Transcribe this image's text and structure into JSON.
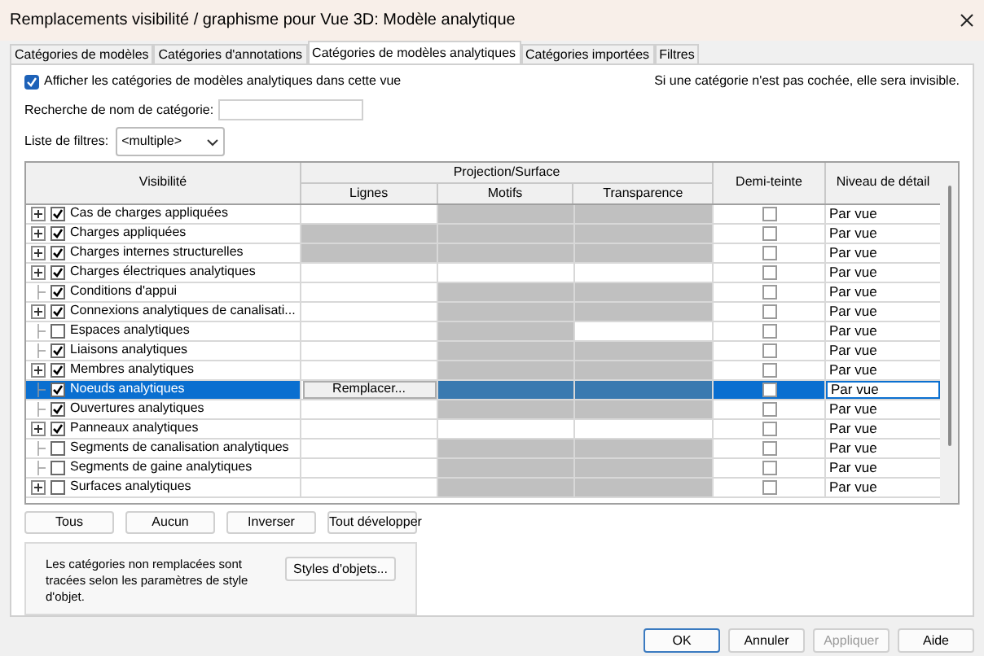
{
  "window": {
    "title": "Remplacements visibilité / graphisme pour Vue 3D: Modèle analytique"
  },
  "tabs": [
    {
      "label": "Catégories de modèles",
      "selected": false
    },
    {
      "label": "Catégories d'annotations",
      "selected": false
    },
    {
      "label": "Catégories de modèles analytiques",
      "selected": true
    },
    {
      "label": "Catégories importées",
      "selected": false
    },
    {
      "label": "Filtres",
      "selected": false
    }
  ],
  "show_categories": {
    "label": "Afficher les catégories de modèles analytiques dans cette vue",
    "checked": true
  },
  "hint": "Si une catégorie n'est pas cochée, elle sera invisible.",
  "search": {
    "label": "Recherche de nom de catégorie:"
  },
  "filter_list": {
    "label": "Liste de filtres:",
    "value": "<multiple>"
  },
  "table": {
    "columns": {
      "visibility": "Visibilité",
      "group": "Projection/Surface",
      "lines": "Lignes",
      "patterns": "Motifs",
      "transparency": "Transparence",
      "halftone": "Demi-teinte",
      "detail": "Niveau de détail"
    },
    "rows": [
      {
        "name": "Cas de charges appliquées",
        "expandable": true,
        "checked": true,
        "selected": false,
        "lines": {
          "shaded": false
        },
        "patterns": {
          "shaded": true
        },
        "transparency": {
          "shaded": true
        },
        "halftone": false,
        "detail": "Par vue"
      },
      {
        "name": "Charges appliquées",
        "expandable": true,
        "checked": true,
        "selected": false,
        "lines": {
          "shaded": true
        },
        "patterns": {
          "shaded": true
        },
        "transparency": {
          "shaded": true
        },
        "halftone": false,
        "detail": "Par vue"
      },
      {
        "name": "Charges internes structurelles",
        "expandable": true,
        "checked": true,
        "selected": false,
        "lines": {
          "shaded": true
        },
        "patterns": {
          "shaded": true
        },
        "transparency": {
          "shaded": true
        },
        "halftone": false,
        "detail": "Par vue"
      },
      {
        "name": "Charges électriques analytiques",
        "expandable": true,
        "checked": true,
        "selected": false,
        "lines": {
          "shaded": false
        },
        "patterns": {
          "shaded": false
        },
        "transparency": {
          "shaded": false
        },
        "halftone": false,
        "detail": "Par vue"
      },
      {
        "name": "Conditions d'appui",
        "expandable": false,
        "checked": true,
        "selected": false,
        "lines": {
          "shaded": false
        },
        "patterns": {
          "shaded": true
        },
        "transparency": {
          "shaded": true
        },
        "halftone": false,
        "detail": "Par vue"
      },
      {
        "name": "Connexions analytiques de canalisati...",
        "expandable": true,
        "checked": true,
        "selected": false,
        "lines": {
          "shaded": false
        },
        "patterns": {
          "shaded": true
        },
        "transparency": {
          "shaded": true
        },
        "halftone": false,
        "detail": "Par vue"
      },
      {
        "name": "Espaces analytiques",
        "expandable": false,
        "checked": false,
        "selected": false,
        "lines": {
          "shaded": false
        },
        "patterns": {
          "shaded": true
        },
        "transparency": {
          "shaded": false
        },
        "halftone": false,
        "detail": "Par vue"
      },
      {
        "name": "Liaisons analytiques",
        "expandable": false,
        "checked": true,
        "selected": false,
        "lines": {
          "shaded": false
        },
        "patterns": {
          "shaded": true
        },
        "transparency": {
          "shaded": true
        },
        "halftone": false,
        "detail": "Par vue"
      },
      {
        "name": "Membres analytiques",
        "expandable": true,
        "checked": true,
        "selected": false,
        "lines": {
          "shaded": false
        },
        "patterns": {
          "shaded": true
        },
        "transparency": {
          "shaded": true
        },
        "halftone": false,
        "detail": "Par vue"
      },
      {
        "name": "Noeuds analytiques",
        "expandable": false,
        "checked": true,
        "selected": true,
        "lines": {
          "shaded": false,
          "button": "Remplacer..."
        },
        "patterns": {
          "shaded": true
        },
        "transparency": {
          "shaded": true
        },
        "halftone": false,
        "detail": "Par vue"
      },
      {
        "name": "Ouvertures analytiques",
        "expandable": false,
        "checked": true,
        "selected": false,
        "lines": {
          "shaded": false
        },
        "patterns": {
          "shaded": true
        },
        "transparency": {
          "shaded": true
        },
        "halftone": false,
        "detail": "Par vue"
      },
      {
        "name": "Panneaux analytiques",
        "expandable": true,
        "checked": true,
        "selected": false,
        "lines": {
          "shaded": false
        },
        "patterns": {
          "shaded": false
        },
        "transparency": {
          "shaded": false
        },
        "halftone": false,
        "detail": "Par vue"
      },
      {
        "name": "Segments de canalisation analytiques",
        "expandable": false,
        "checked": false,
        "selected": false,
        "lines": {
          "shaded": false
        },
        "patterns": {
          "shaded": true
        },
        "transparency": {
          "shaded": true
        },
        "halftone": false,
        "detail": "Par vue"
      },
      {
        "name": "Segments de gaine analytiques",
        "expandable": false,
        "checked": false,
        "selected": false,
        "lines": {
          "shaded": false
        },
        "patterns": {
          "shaded": true
        },
        "transparency": {
          "shaded": true
        },
        "halftone": false,
        "detail": "Par vue"
      },
      {
        "name": "Surfaces analytiques",
        "expandable": true,
        "checked": false,
        "selected": false,
        "lines": {
          "shaded": false
        },
        "patterns": {
          "shaded": true
        },
        "transparency": {
          "shaded": true
        },
        "halftone": false,
        "detail": "Par vue"
      }
    ]
  },
  "table_buttons": [
    "Tous",
    "Aucun",
    "Inverser",
    "Tout développer"
  ],
  "note": {
    "text": "Les catégories non remplacées sont tracées selon les paramètres de style d'objet.",
    "button": "Styles d'objets..."
  },
  "footer_buttons": [
    {
      "label": "OK",
      "disabled": false,
      "default": true
    },
    {
      "label": "Annuler",
      "disabled": false,
      "default": false
    },
    {
      "label": "Appliquer",
      "disabled": true,
      "default": false
    },
    {
      "label": "Aide",
      "disabled": false,
      "default": false
    }
  ]
}
